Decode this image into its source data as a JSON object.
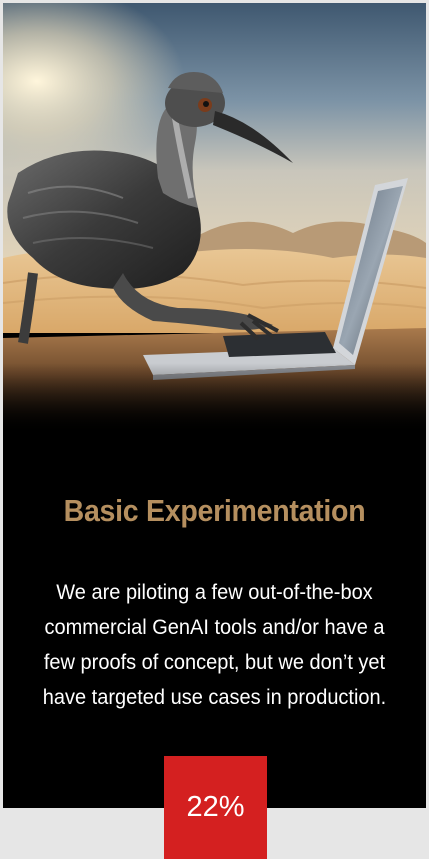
{
  "card": {
    "image": {
      "subject": "emu-using-laptop-in-desert"
    },
    "title": "Basic Experimentation",
    "description": "We are piloting a few out-of-the-box commercial GenAI tools and/or have a few proofs of concept, but we don’t yet have targeted use cases in production.",
    "percentage": "22%"
  },
  "colors": {
    "page_background": "#e6e6e6",
    "card_background": "#000000",
    "title": "#b58f5f",
    "body_text": "#ffffff",
    "badge_background": "#d42020",
    "badge_text": "#ffffff"
  }
}
